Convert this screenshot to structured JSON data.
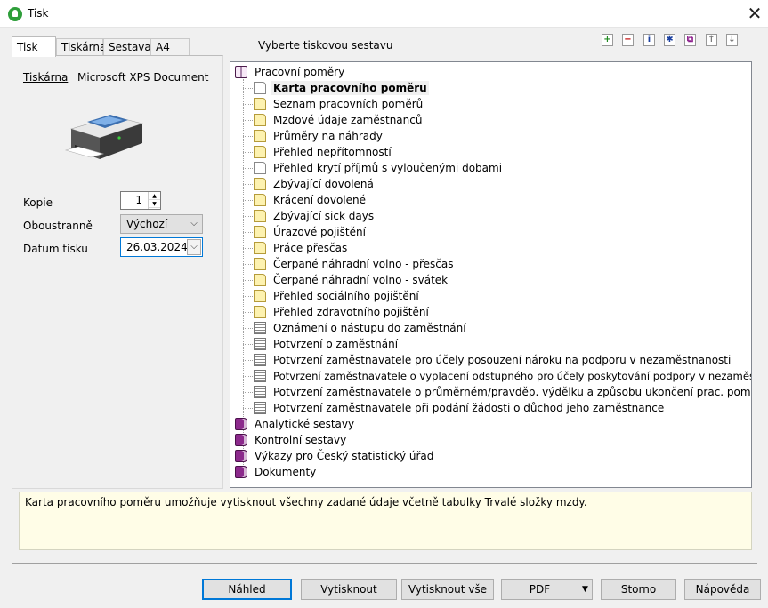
{
  "window": {
    "title": "Tisk",
    "close_glyph": "✕"
  },
  "tabs": [
    {
      "label": "Tisk",
      "active": true
    },
    {
      "label": "Tiskárna",
      "active": false
    },
    {
      "label": "Sestava",
      "active": false
    },
    {
      "label": "A4",
      "active": false
    }
  ],
  "report_header": "Vyberte tiskovou sestavu",
  "toolbar": [
    {
      "icon": "add-icon",
      "glyph": "+",
      "color": "#1f8a1f"
    },
    {
      "icon": "remove-icon",
      "glyph": "−",
      "color": "#c00000"
    },
    {
      "icon": "info-icon",
      "glyph": "i",
      "color": "#1a3fa0"
    },
    {
      "icon": "new-icon",
      "glyph": "✱",
      "color": "#1a3fa0"
    },
    {
      "icon": "copy-icon",
      "glyph": "⧉",
      "color": "#8a1a8a"
    },
    {
      "icon": "move-up-icon",
      "glyph": "↑",
      "color": "#777777"
    },
    {
      "icon": "move-down-icon",
      "glyph": "↓",
      "color": "#777777"
    }
  ],
  "printer": {
    "label": "Tiskárna",
    "name": "Microsoft XPS Document"
  },
  "form": {
    "copies_label": "Kopie",
    "copies_value": "1",
    "duplex_label": "Oboustranně",
    "duplex_value": "Výchozí",
    "date_label": "Datum tisku",
    "date_value": "26.03.2024"
  },
  "tree": {
    "root": {
      "label": "Pracovní poměry",
      "icon": "open-book-icon"
    },
    "children": [
      {
        "label": "Karta pracovního poměru",
        "icon": "doc-white",
        "selected": true
      },
      {
        "label": "Seznam pracovních poměrů",
        "icon": "doc-yellow"
      },
      {
        "label": "Mzdové údaje zaměstnanců",
        "icon": "doc-yellow"
      },
      {
        "label": "Průměry na náhrady",
        "icon": "doc-yellow"
      },
      {
        "label": "Přehled nepřítomností",
        "icon": "doc-yellow"
      },
      {
        "label": "Přehled krytí příjmů s vyloučenými dobami",
        "icon": "doc-white"
      },
      {
        "label": "Zbývající dovolená",
        "icon": "doc-yellow"
      },
      {
        "label": "Krácení dovolené",
        "icon": "doc-yellow"
      },
      {
        "label": "Zbývající sick days",
        "icon": "doc-yellow"
      },
      {
        "label": "Úrazové pojištění",
        "icon": "doc-yellow"
      },
      {
        "label": "Práce přesčas",
        "icon": "doc-yellow"
      },
      {
        "label": "Čerpané náhradní volno - přesčas",
        "icon": "doc-yellow"
      },
      {
        "label": "Čerpané náhradní volno - svátek",
        "icon": "doc-yellow"
      },
      {
        "label": "Přehled sociálního pojištění",
        "icon": "doc-yellow"
      },
      {
        "label": "Přehled zdravotního pojištění",
        "icon": "doc-yellow"
      },
      {
        "label": "Oznámení o nástupu do zaměstnání",
        "icon": "doc-lines"
      },
      {
        "label": "Potvrzení o zaměstnání",
        "icon": "doc-lines"
      },
      {
        "label": "Potvrzení zaměstnavatele pro účely posouzení nároku na podporu v nezaměstnanosti",
        "icon": "doc-lines"
      },
      {
        "label": "Potvrzení zaměstnavatele o vyplacení odstupného pro účely poskytování podpory v nezaměstnanosti",
        "icon": "doc-lines"
      },
      {
        "label": "Potvrzení zaměstnavatele o průměrném/pravděp. výdělku a způsobu ukončení prac. poměru",
        "icon": "doc-lines"
      },
      {
        "label": "Potvrzení zaměstnavatele při podání žádosti o důchod jeho zaměstnance",
        "icon": "doc-lines"
      }
    ],
    "groups": [
      {
        "label": "Analytické sestavy",
        "icon": "closed-book-icon"
      },
      {
        "label": "Kontrolní sestavy",
        "icon": "closed-book-icon"
      },
      {
        "label": "Výkazy pro Český statistický úřad",
        "icon": "closed-book-icon"
      },
      {
        "label": "Dokumenty",
        "icon": "closed-book-icon"
      }
    ]
  },
  "description": "Karta pracovního poměru umožňuje vytisknout všechny zadané údaje včetně tabulky Trvalé složky mzdy.",
  "buttons": {
    "preview": "Náhled",
    "print": "Vytisknout",
    "print_all": "Vytisknout vše",
    "pdf": "PDF",
    "cancel": "Storno",
    "help": "Nápověda"
  },
  "colors": {
    "accent": "#0078d7",
    "description_bg": "#fffde7"
  }
}
